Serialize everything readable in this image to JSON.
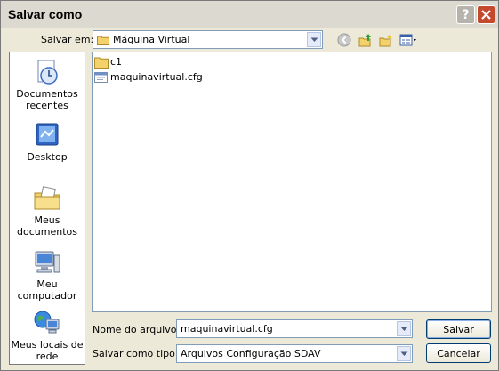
{
  "window": {
    "title": "Salvar como"
  },
  "title_buttons": {
    "help": "?",
    "close": "close-icon"
  },
  "toolbar": {
    "save_in_label": "Salvar em:",
    "save_in_value": "Máquina Virtual"
  },
  "places": [
    {
      "label": "Documentos recentes",
      "icon": "recent-documents-icon"
    },
    {
      "label": "Desktop",
      "icon": "desktop-icon"
    },
    {
      "label": "Meus documentos",
      "icon": "my-documents-icon"
    },
    {
      "label": "Meu computador",
      "icon": "my-computer-icon"
    },
    {
      "label": "Meus locais de rede",
      "icon": "network-places-icon"
    }
  ],
  "files": [
    {
      "name": "c1",
      "type": "folder"
    },
    {
      "name": "maquinavirtual.cfg",
      "type": "file"
    }
  ],
  "form": {
    "filename_label": "Nome do arquivo:",
    "filename_value": "maquinavirtual.cfg",
    "filetype_label": "Salvar como tipo:",
    "filetype_value": "Arquivos Configuração SDAV"
  },
  "buttons": {
    "save": "Salvar",
    "cancel": "Cancelar"
  },
  "colors": {
    "accent": "#7f9db9",
    "close": "#c34a2d",
    "dialog": "#ece9d8"
  }
}
